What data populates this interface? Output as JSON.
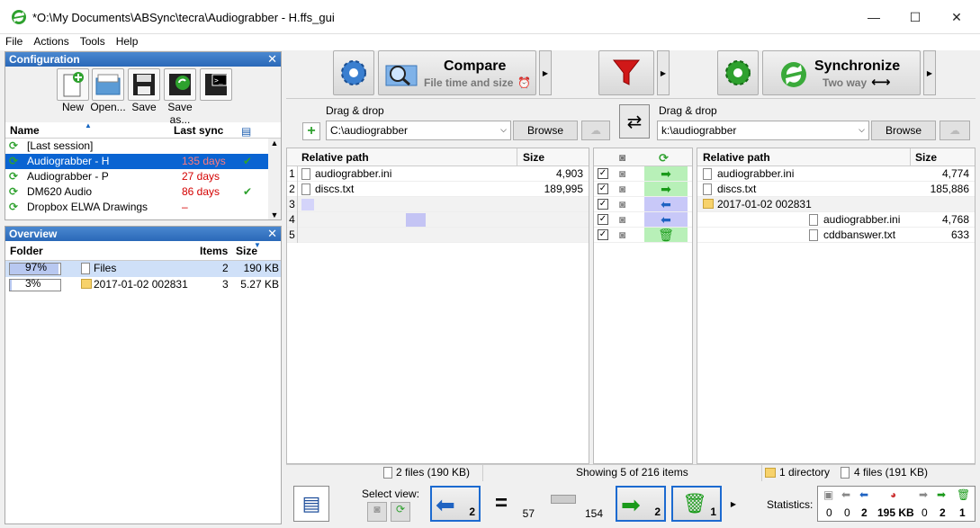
{
  "window": {
    "title": "*O:\\My Documents\\ABSync\\tecra\\Audiograbber - H.ffs_gui",
    "minimize": "—",
    "maximize": "☐",
    "close": "✕"
  },
  "menu": [
    "File",
    "Actions",
    "Tools",
    "Help"
  ],
  "configuration": {
    "title": "Configuration",
    "buttons": [
      "New",
      "Open...",
      "Save",
      "Save as..."
    ],
    "columns": {
      "name": "Name",
      "last_sync": "Last sync"
    },
    "items": [
      {
        "name": "[Last session]",
        "last_sync": "",
        "check": false,
        "selected": false
      },
      {
        "name": "Audiograbber - H",
        "last_sync": "135 days",
        "check": true,
        "selected": true
      },
      {
        "name": "Audiograbber - P",
        "last_sync": "27 days",
        "check": false,
        "selected": false
      },
      {
        "name": "DM620 Audio",
        "last_sync": "86 days",
        "check": true,
        "selected": false
      },
      {
        "name": "Dropbox ELWA Drawings",
        "last_sync": "–",
        "check": false,
        "selected": false
      }
    ]
  },
  "overview": {
    "title": "Overview",
    "columns": {
      "folder": "Folder",
      "items": "Items",
      "size": "Size"
    },
    "rows": [
      {
        "pct": "97%",
        "pct_value": 97,
        "name": "Files",
        "items": "2",
        "size": "190 KB"
      },
      {
        "pct": "3%",
        "pct_value": 3,
        "name": "2017-01-02 002831",
        "items": "3",
        "size": "5.27 KB"
      }
    ]
  },
  "toolbar": {
    "compare_label": "Compare",
    "compare_sub": "File time and size",
    "sync_label": "Synchronize",
    "sync_sub": "Two way"
  },
  "left": {
    "drag_drop": "Drag & drop",
    "path": "C:\\audiograbber",
    "browse": "Browse",
    "col_path": "Relative path",
    "col_size": "Size",
    "rows": [
      {
        "n": "1",
        "name": "audiograbber.ini",
        "size": "4,903"
      },
      {
        "n": "2",
        "name": "discs.txt",
        "size": "189,995"
      },
      {
        "n": "3",
        "name": "",
        "size": ""
      },
      {
        "n": "4",
        "name": "",
        "size": ""
      },
      {
        "n": "5",
        "name": "",
        "size": ""
      }
    ]
  },
  "right": {
    "drag_drop": "Drag & drop",
    "path": "k:\\audiograbber",
    "browse": "Browse",
    "col_path": "Relative path",
    "col_size": "Size",
    "rows": [
      {
        "name": "audiograbber.ini",
        "size": "4,774",
        "indent": 0,
        "type": "file"
      },
      {
        "name": "discs.txt",
        "size": "185,886",
        "indent": 0,
        "type": "file"
      },
      {
        "name": "2017-01-02 002831",
        "size": "",
        "indent": 0,
        "type": "folder"
      },
      {
        "name": "audiograbber.ini",
        "size": "4,768",
        "indent": 1,
        "type": "file"
      },
      {
        "name": "cddbanswer.txt",
        "size": "633",
        "indent": 1,
        "type": "file"
      }
    ]
  },
  "status": {
    "left_files": "2 files (190 KB)",
    "showing": "Showing 5 of 216 items",
    "right_dir": "1 directory",
    "right_files": "4 files (191 KB)"
  },
  "bottom": {
    "select_view": "Select view:",
    "counts": [
      "2",
      "57",
      "154",
      "2",
      "1"
    ],
    "statistics_label": "Statistics:",
    "stats": [
      "0",
      "0",
      "2",
      "195 KB",
      "0",
      "2",
      "1"
    ]
  },
  "colors": {
    "accent": "#0078d7",
    "selected": "#0a64d2",
    "red": "#d40000",
    "green_arrow": "#1a9a1a"
  }
}
